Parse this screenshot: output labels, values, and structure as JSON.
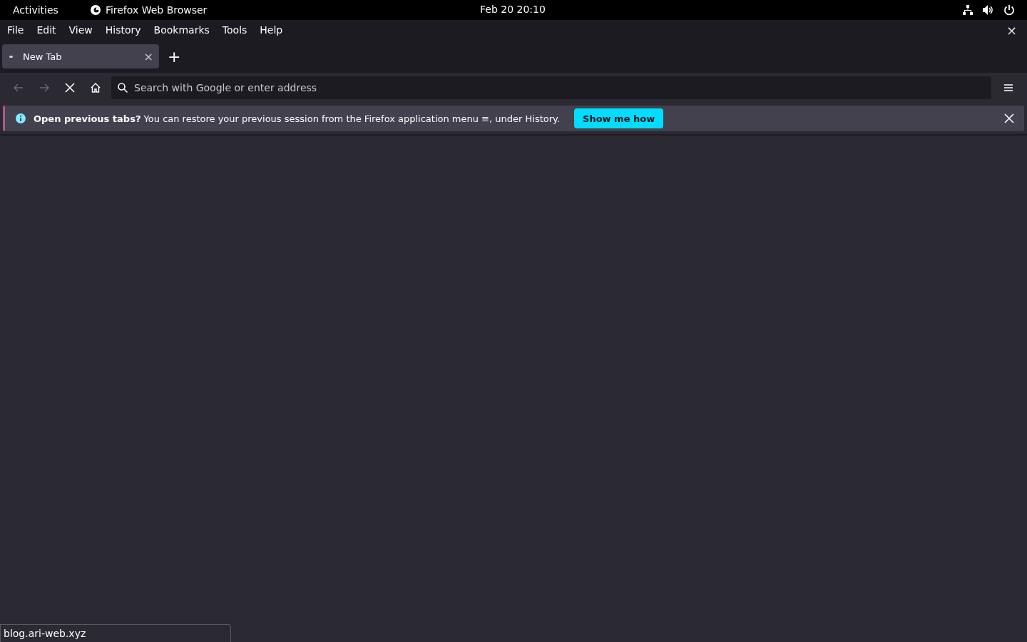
{
  "top_bar": {
    "activities": "Activities",
    "app_name": "Firefox Web Browser",
    "clock": "Feb 20  20:10"
  },
  "menu_bar": {
    "items": [
      "File",
      "Edit",
      "View",
      "History",
      "Bookmarks",
      "Tools",
      "Help"
    ],
    "close": "×"
  },
  "tabs": [
    {
      "label": "New Tab",
      "selected": true,
      "close": "×"
    }
  ],
  "new_tab": "+",
  "nav_bar": {
    "back_disabled": true,
    "forward_disabled": true,
    "url_placeholder": "Search with Google or enter address"
  },
  "notification": {
    "message": "**Open previous tabs?** You can restore your previous session from the Firefox application menu ≡, under History.",
    "button": "Show me how"
  },
  "status_link": "blog.ari-web.xyz"
}
